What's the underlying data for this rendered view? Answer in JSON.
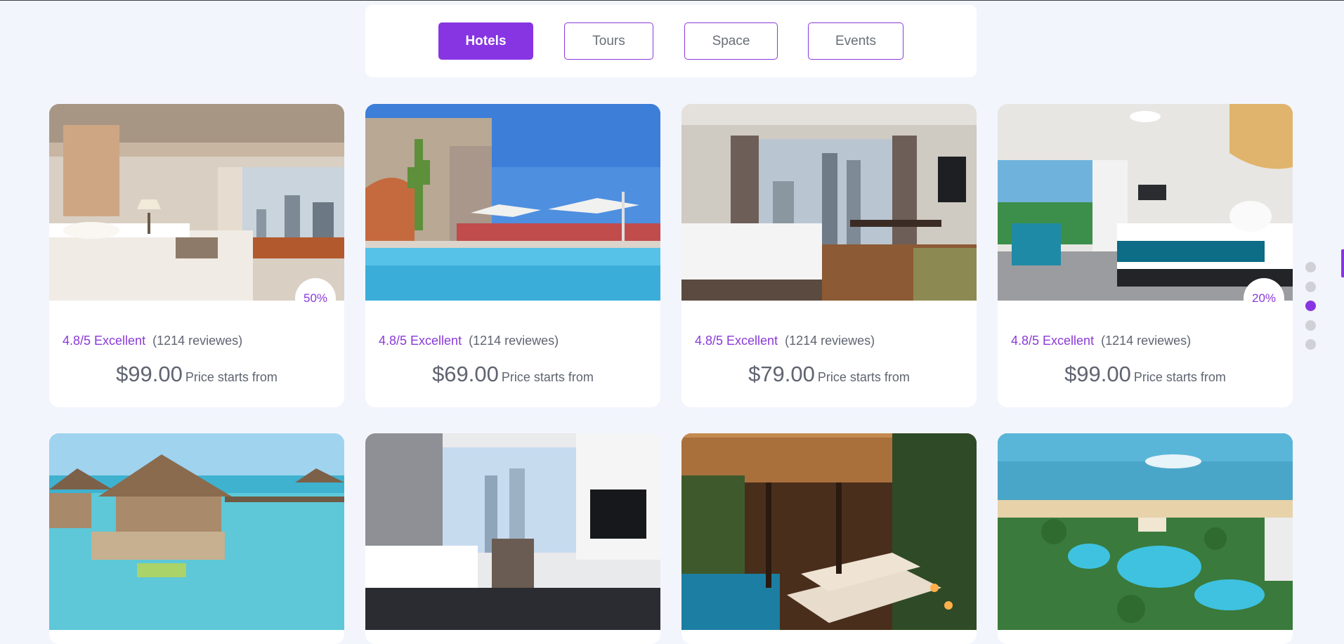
{
  "tabs": [
    {
      "label": "Hotels",
      "active": true
    },
    {
      "label": "Tours",
      "active": false
    },
    {
      "label": "Space",
      "active": false
    },
    {
      "label": "Events",
      "active": false
    }
  ],
  "cards": [
    {
      "image": "hotel-bedroom-city-view",
      "badge": "50%",
      "rating": "4.8/5 Excellent",
      "reviews": "(1214 reviewes)",
      "price": "$99.00",
      "price_note": "Price starts from"
    },
    {
      "image": "rooftop-pool-cactus",
      "badge": "",
      "rating": "4.8/5 Excellent",
      "reviews": "(1214 reviewes)",
      "price": "$69.00",
      "price_note": "Price starts from"
    },
    {
      "image": "hotel-room-skyline",
      "badge": "",
      "rating": "4.8/5 Excellent",
      "reviews": "(1214 reviewes)",
      "price": "$79.00",
      "price_note": "Price starts from"
    },
    {
      "image": "ocean-view-teal-bedroom",
      "badge": "20%",
      "rating": "4.8/5 Excellent",
      "reviews": "(1214 reviewes)",
      "price": "$99.00",
      "price_note": "Price starts from"
    },
    {
      "image": "overwater-bungalow"
    },
    {
      "image": "city-view-suite"
    },
    {
      "image": "spa-lounge"
    },
    {
      "image": "beach-resort-pool"
    }
  ],
  "pager": {
    "count": 5,
    "active_index": 2
  },
  "colors": {
    "accent": "#8735e2",
    "background": "#f3f5fd",
    "text": "#5f6470"
  }
}
